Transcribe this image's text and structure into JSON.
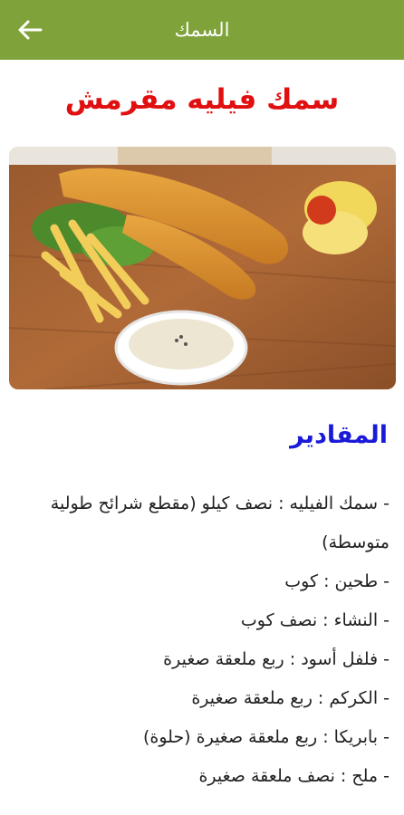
{
  "appbar": {
    "title": "السمك",
    "back_icon": "arrow-left-icon"
  },
  "recipe": {
    "title": "سمك فيليه مقرمش"
  },
  "photo": {
    "description_icon": "fish-fillet-photo"
  },
  "ingredients": {
    "heading": "المقادير",
    "items": [
      "- سمك الفيليه : نصف كيلو (مقطع شرائح طولية متوسطة)",
      "- طحين : كوب",
      "- النشاء : نصف كوب",
      "- فلفل أسود : ربع ملعقة صغيرة",
      "- الكركم : ربع ملعقة صغيرة",
      "- بابريكا : ربع ملعقة صغيرة (حلوة)",
      "- ملح : نصف ملعقة صغيرة"
    ]
  },
  "colors": {
    "appbar": "#7fa33a",
    "title": "#e01010",
    "heading": "#1a1ad8"
  }
}
